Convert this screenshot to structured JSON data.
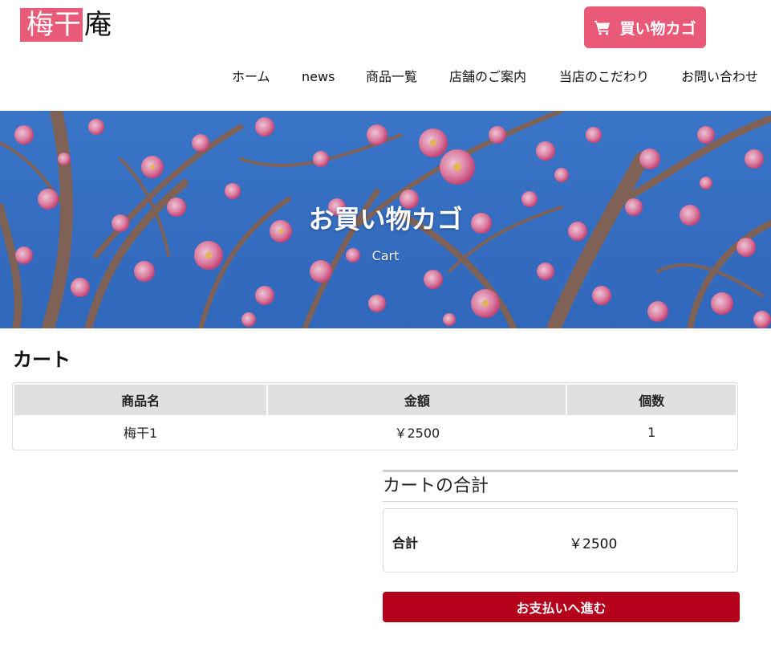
{
  "header": {
    "logo_highlight": "梅干",
    "logo_rest": "庵",
    "cart_button_label": "買い物カゴ",
    "cart_icon": "shopping-cart-icon"
  },
  "nav": {
    "items": [
      {
        "label": "ホーム"
      },
      {
        "label": "news"
      },
      {
        "label": "商品一覧"
      },
      {
        "label": "店舗のご案内"
      },
      {
        "label": "当店のこだわり"
      },
      {
        "label": "お問い合わせ"
      }
    ]
  },
  "hero": {
    "title": "お買い物カゴ",
    "subtitle": "Cart"
  },
  "cart": {
    "title": "カート",
    "columns": [
      "商品名",
      "金額",
      "個数"
    ],
    "rows": [
      {
        "name": "梅干1",
        "price": "￥2500",
        "qty": "1"
      }
    ]
  },
  "totals": {
    "title": "カートの合計",
    "label": "合計",
    "value": "￥2500"
  },
  "checkout": {
    "label": "お支払いへ進む"
  },
  "colors": {
    "accent_pink": "#e85a78",
    "checkout_red": "#b5001c",
    "sky_blue": "#3b78d4"
  }
}
